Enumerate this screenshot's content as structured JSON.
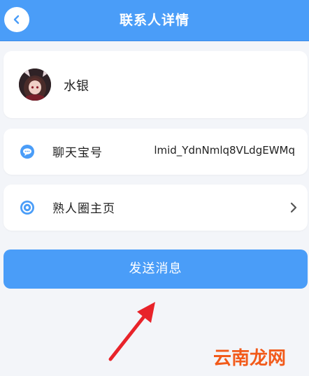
{
  "header": {
    "title": "联系人详情",
    "back_icon": "chevron-left-icon"
  },
  "profile": {
    "name": "水银",
    "avatar": "avatar-image"
  },
  "chat_id_row": {
    "label": "聊天宝号",
    "value": "lmid_YdnNmlq8VLdgEWMq",
    "icon": "chat-bubble-icon"
  },
  "moments_row": {
    "label": "熟人圈主页",
    "icon": "moments-icon",
    "chevron_icon": "chevron-right-icon"
  },
  "send_button": {
    "label": "发送消息"
  },
  "watermark": {
    "text": "云南龙网"
  },
  "colors": {
    "accent": "#4a9df8",
    "background": "#f3f5f9",
    "arrow": "#e8232a",
    "watermark": "#f25a1a"
  }
}
